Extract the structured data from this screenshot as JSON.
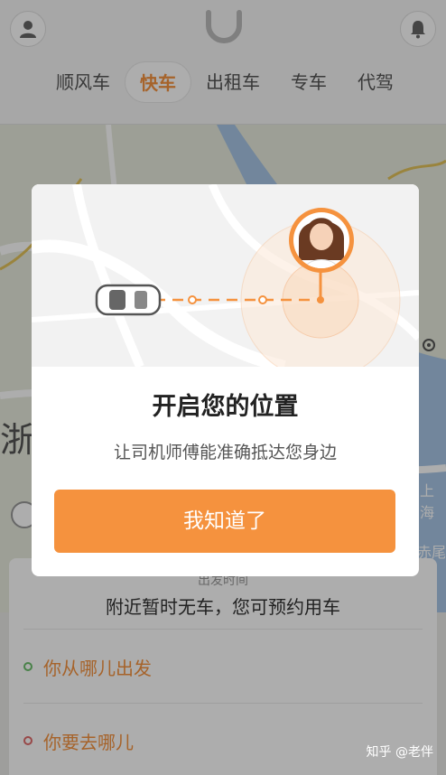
{
  "header": {
    "tabs": [
      {
        "label": "顺风车"
      },
      {
        "label": "快车",
        "active": true
      },
      {
        "label": "出租车"
      },
      {
        "label": "专车"
      },
      {
        "label": "代驾"
      }
    ]
  },
  "map": {
    "labels": [
      "上海",
      "赤尾",
      "浙"
    ]
  },
  "bottom_sheet": {
    "depart_time": "出发时间",
    "notice": "附近暂时无车，您可预约用车",
    "from_placeholder": "你从哪儿出发",
    "to_placeholder": "你要去哪儿"
  },
  "dialog": {
    "title": "开启您的位置",
    "subtitle": "让司机师傅能准确抵达您身边",
    "button": "我知道了"
  },
  "watermark": "知乎 @老伴",
  "colors": {
    "accent": "#f5923e",
    "from_dot": "#6bbf6b",
    "to_dot": "#e06a6a"
  }
}
